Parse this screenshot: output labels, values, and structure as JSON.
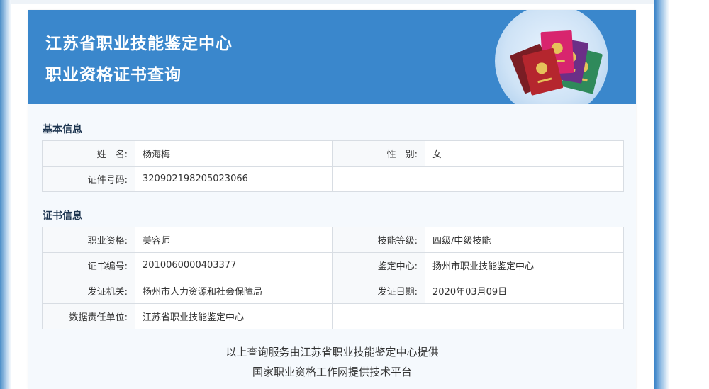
{
  "header": {
    "title_line1": "江苏省职业技能鉴定中心",
    "title_line2": "职业资格证书查询"
  },
  "basic_info": {
    "section_title": "基本信息",
    "name_label": "姓　名:",
    "name_value": "杨海梅",
    "gender_label": "性　别:",
    "gender_value": "女",
    "id_label": "证件号码:",
    "id_value": "320902198205023066"
  },
  "cert_info": {
    "section_title": "证书信息",
    "qualification_label": "职业资格:",
    "qualification_value": "美容师",
    "skill_level_label": "技能等级:",
    "skill_level_value": "四级/中级技能",
    "cert_no_label": "证书编号:",
    "cert_no_value": "2010060000403377",
    "center_label": "鉴定中心:",
    "center_value": "扬州市职业技能鉴定中心",
    "issuer_label": "发证机关:",
    "issuer_value": "扬州市人力资源和社会保障局",
    "issue_date_label": "发证日期:",
    "issue_date_value": "2020年03月09日",
    "data_unit_label": "数据责任单位:",
    "data_unit_value": "江苏省职业技能鉴定中心"
  },
  "footer": {
    "line1": "以上查询服务由江苏省职业技能鉴定中心提供",
    "line2": "国家职业资格工作网提供技术平台"
  },
  "colors": {
    "banner": "#3a87cc",
    "page_bg": "#f5f9fd",
    "table_border": "#d8dde3",
    "section_title": "#1d3550"
  },
  "icons": [
    "certificate-booklets-icon"
  ]
}
